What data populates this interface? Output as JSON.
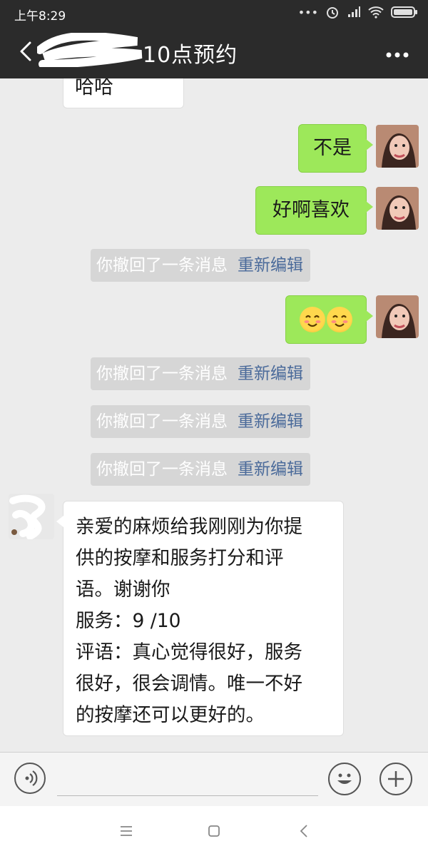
{
  "status": {
    "time": "上午8:29"
  },
  "header": {
    "title": "10点预约"
  },
  "messages": {
    "partial_top": "哈哈",
    "out1": "不是",
    "out2": "好啊喜欢",
    "recall_text": "你撤回了一条消息",
    "recall_edit": "重新编辑",
    "long_lines": [
      "亲爱的麻烦给我刚刚为你提",
      "供的按摩和服务打分和评",
      "语。谢谢你",
      "服务：9 /10",
      "评语：真心觉得很好，服务",
      "很好，很会调情。唯一不好",
      "的按摩还可以更好的。"
    ]
  },
  "icons": {
    "back": "chevron-left-icon",
    "more": "more-dots-icon",
    "voice": "voice-icon",
    "emoji": "emoji-icon",
    "plus": "plus-icon"
  },
  "colors": {
    "bubble_out": "#9de85a",
    "header": "#2b2b2b",
    "recall_edit": "#4a6a9a"
  }
}
